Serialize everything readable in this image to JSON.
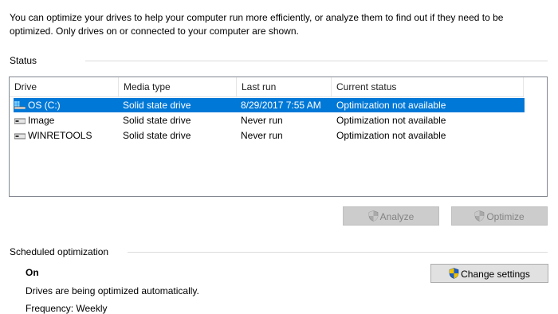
{
  "intro": "You can optimize your drives to help your computer run more efficiently, or analyze them to find out if they need to be optimized. Only drives on or connected to your computer are shown.",
  "status": {
    "section_label": "Status",
    "columns": [
      "Drive",
      "Media type",
      "Last run",
      "Current status"
    ],
    "drives": [
      {
        "name": "OS (C:)",
        "media_type": "Solid state drive",
        "last_run": "8/29/2017 7:55 AM",
        "status": "Optimization not available",
        "selected": true,
        "icon": "windows-drive-icon"
      },
      {
        "name": "Image",
        "media_type": "Solid state drive",
        "last_run": "Never run",
        "status": "Optimization not available",
        "selected": false,
        "icon": "drive-icon"
      },
      {
        "name": "WINRETOOLS",
        "media_type": "Solid state drive",
        "last_run": "Never run",
        "status": "Optimization not available",
        "selected": false,
        "icon": "drive-icon"
      }
    ],
    "analyze_label": "Analyze",
    "optimize_label": "Optimize"
  },
  "scheduled": {
    "section_label": "Scheduled optimization",
    "state": "On",
    "description": "Drives are being optimized automatically.",
    "frequency": "Frequency: Weekly",
    "change_settings_label": "Change settings"
  },
  "colors": {
    "selection": "#0078d7",
    "shield_blue": "#1f5fbf",
    "shield_yellow": "#f2c200"
  }
}
